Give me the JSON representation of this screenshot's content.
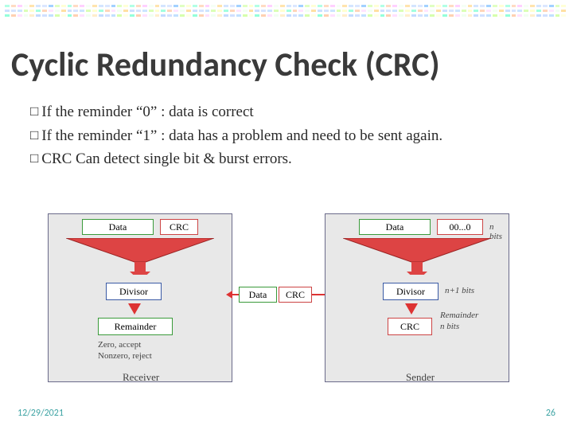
{
  "slide": {
    "title": "Cyclic Redundancy Check (CRC)"
  },
  "bullets": {
    "b1": "If the reminder “0” : data is correct",
    "b2": "If the reminder “1” : data has a problem and need to be sent again.",
    "b3": "CRC Can detect single bit & burst errors."
  },
  "diagram": {
    "left": {
      "data": "Data",
      "crc": "CRC",
      "divisor": "Divisor",
      "remainder": "Remainder",
      "note1": "Zero, accept",
      "note2": "Nonzero, reject",
      "label": "Receiver"
    },
    "middle": {
      "data": "Data",
      "crc": "CRC"
    },
    "right": {
      "data": "Data",
      "zeros": "00...0",
      "divisor": "Divisor",
      "crc": "CRC",
      "nbits": "n bits",
      "np1": "n+1 bits",
      "remainder": "Remainder",
      "label": "Sender"
    }
  },
  "footer": {
    "date": "12/29/2021",
    "page": "26"
  },
  "colors": {
    "green_border": "#3a9a3a",
    "blue_border": "#3a5aa5",
    "red_border": "#c44"
  }
}
